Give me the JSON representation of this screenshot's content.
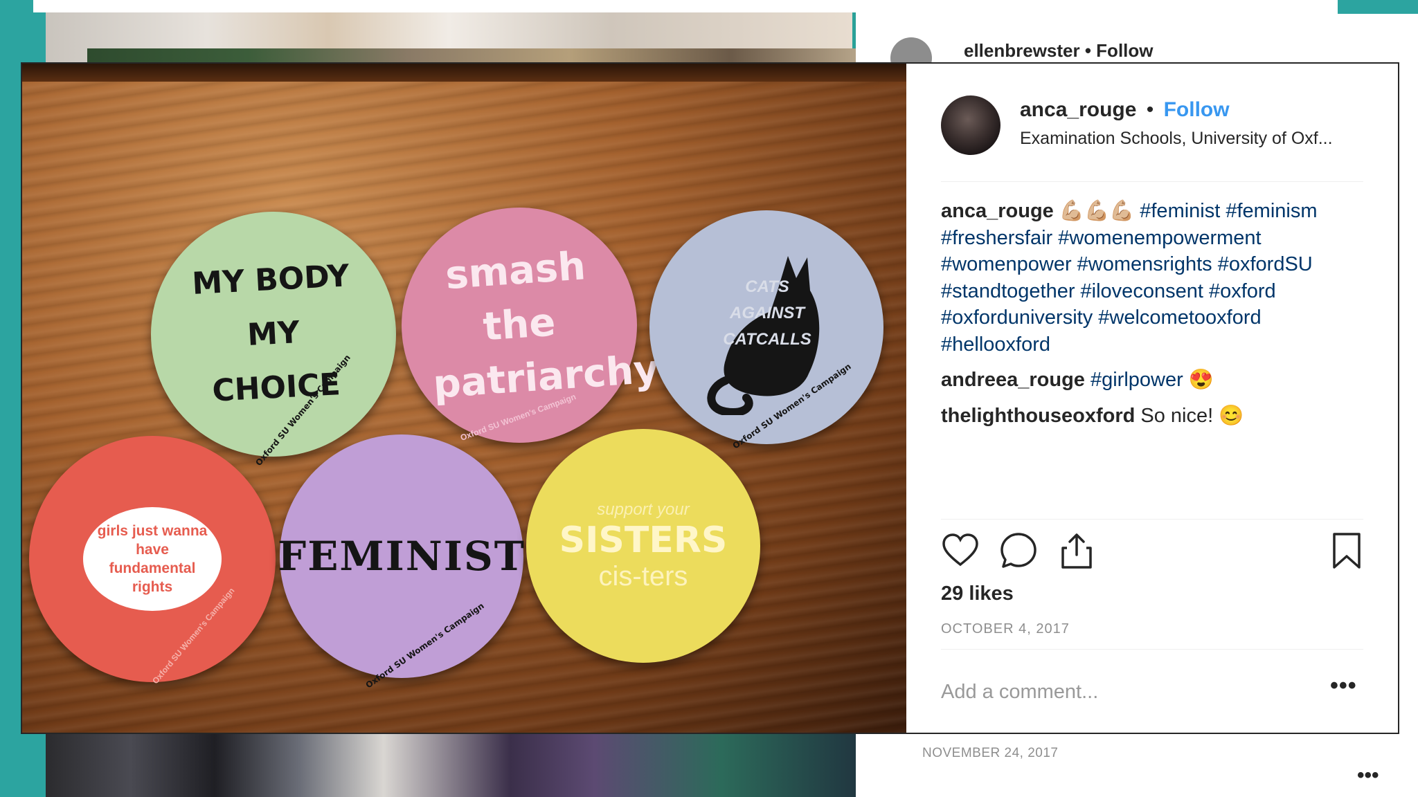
{
  "background": {
    "behind_user": "ellenbrewster • Follow",
    "behind_date": "NOVEMBER 24, 2017",
    "behind_more": "•••"
  },
  "photo": {
    "stickers": [
      {
        "text": "MY BODY MY CHOICE",
        "footer": "Oxford SU Women's Campaign"
      },
      {
        "text": "smash the patriarchy",
        "footer": "Oxford SU Women's Campaign"
      },
      {
        "text": "CATS AGAINST CATCALLS",
        "footer": "Oxford SU Women's Campaign"
      },
      {
        "text": "girls just wanna have fundamental rights",
        "footer": "Oxford SU Women's Campaign"
      },
      {
        "text": "FEMINIST",
        "footer": "Oxford SU Women's Campaign"
      },
      {
        "text": "SISTERS",
        "top": "support your",
        "bottom": "cis-ters",
        "footer": ""
      }
    ]
  },
  "post": {
    "username": "anca_rouge",
    "dot": "•",
    "follow_label": "Follow",
    "location": "Examination Schools, University of Oxf...",
    "caption": {
      "user": "anca_rouge",
      "emoji": "💪🏼💪🏼💪🏼",
      "hashtags": "#feminist #feminism #freshersfair #womenempowerment #womenpower #womensrights #oxfordSU #standtogether #iloveconsent #oxford #oxforduniversity #welcometooxford #hellooxford"
    },
    "comments": [
      {
        "user": "andreea_rouge",
        "text": "#girlpower",
        "emoji": "😍"
      },
      {
        "user": "thelighthouseoxford",
        "text": "So nice!",
        "emoji": "😊"
      }
    ],
    "likes": "29 likes",
    "date": "OCTOBER 4, 2017",
    "add_comment_placeholder": "Add a comment...",
    "more_label": "•••"
  },
  "colors": {
    "follow": "#3897f0",
    "hashtag": "#003569",
    "teal": "#2ca4a0"
  },
  "icons": [
    "heart-icon",
    "comment-icon",
    "share-icon",
    "bookmark-icon",
    "more-icon"
  ]
}
